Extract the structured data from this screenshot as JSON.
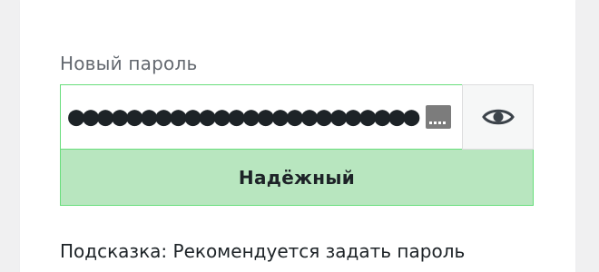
{
  "password_field": {
    "label": "Новый пароль",
    "value": "●●●●●●●●●●●●●●●●●●●●●●●●",
    "show_button_icon": "eye-icon",
    "password_manager_icon": "key-autofill-icon"
  },
  "strength": {
    "label": "Надёжный",
    "color": "#b8e6bf",
    "border_color": "#68de7c"
  },
  "hint": {
    "text": "Подсказка: Рекомендуется задать пароль"
  }
}
